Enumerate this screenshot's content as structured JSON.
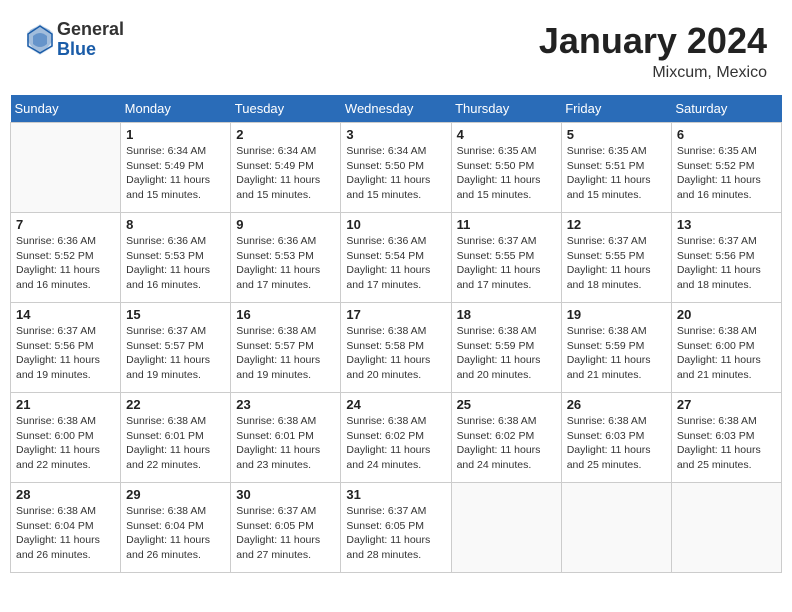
{
  "header": {
    "logo_general": "General",
    "logo_blue": "Blue",
    "month_title": "January 2024",
    "location": "Mixcum, Mexico"
  },
  "weekdays": [
    "Sunday",
    "Monday",
    "Tuesday",
    "Wednesday",
    "Thursday",
    "Friday",
    "Saturday"
  ],
  "weeks": [
    [
      {
        "day": "",
        "sunrise": "",
        "sunset": "",
        "daylight": ""
      },
      {
        "day": "1",
        "sunrise": "Sunrise: 6:34 AM",
        "sunset": "Sunset: 5:49 PM",
        "daylight": "Daylight: 11 hours and 15 minutes."
      },
      {
        "day": "2",
        "sunrise": "Sunrise: 6:34 AM",
        "sunset": "Sunset: 5:49 PM",
        "daylight": "Daylight: 11 hours and 15 minutes."
      },
      {
        "day": "3",
        "sunrise": "Sunrise: 6:34 AM",
        "sunset": "Sunset: 5:50 PM",
        "daylight": "Daylight: 11 hours and 15 minutes."
      },
      {
        "day": "4",
        "sunrise": "Sunrise: 6:35 AM",
        "sunset": "Sunset: 5:50 PM",
        "daylight": "Daylight: 11 hours and 15 minutes."
      },
      {
        "day": "5",
        "sunrise": "Sunrise: 6:35 AM",
        "sunset": "Sunset: 5:51 PM",
        "daylight": "Daylight: 11 hours and 15 minutes."
      },
      {
        "day": "6",
        "sunrise": "Sunrise: 6:35 AM",
        "sunset": "Sunset: 5:52 PM",
        "daylight": "Daylight: 11 hours and 16 minutes."
      }
    ],
    [
      {
        "day": "7",
        "sunrise": "Sunrise: 6:36 AM",
        "sunset": "Sunset: 5:52 PM",
        "daylight": "Daylight: 11 hours and 16 minutes."
      },
      {
        "day": "8",
        "sunrise": "Sunrise: 6:36 AM",
        "sunset": "Sunset: 5:53 PM",
        "daylight": "Daylight: 11 hours and 16 minutes."
      },
      {
        "day": "9",
        "sunrise": "Sunrise: 6:36 AM",
        "sunset": "Sunset: 5:53 PM",
        "daylight": "Daylight: 11 hours and 17 minutes."
      },
      {
        "day": "10",
        "sunrise": "Sunrise: 6:36 AM",
        "sunset": "Sunset: 5:54 PM",
        "daylight": "Daylight: 11 hours and 17 minutes."
      },
      {
        "day": "11",
        "sunrise": "Sunrise: 6:37 AM",
        "sunset": "Sunset: 5:55 PM",
        "daylight": "Daylight: 11 hours and 17 minutes."
      },
      {
        "day": "12",
        "sunrise": "Sunrise: 6:37 AM",
        "sunset": "Sunset: 5:55 PM",
        "daylight": "Daylight: 11 hours and 18 minutes."
      },
      {
        "day": "13",
        "sunrise": "Sunrise: 6:37 AM",
        "sunset": "Sunset: 5:56 PM",
        "daylight": "Daylight: 11 hours and 18 minutes."
      }
    ],
    [
      {
        "day": "14",
        "sunrise": "Sunrise: 6:37 AM",
        "sunset": "Sunset: 5:56 PM",
        "daylight": "Daylight: 11 hours and 19 minutes."
      },
      {
        "day": "15",
        "sunrise": "Sunrise: 6:37 AM",
        "sunset": "Sunset: 5:57 PM",
        "daylight": "Daylight: 11 hours and 19 minutes."
      },
      {
        "day": "16",
        "sunrise": "Sunrise: 6:38 AM",
        "sunset": "Sunset: 5:57 PM",
        "daylight": "Daylight: 11 hours and 19 minutes."
      },
      {
        "day": "17",
        "sunrise": "Sunrise: 6:38 AM",
        "sunset": "Sunset: 5:58 PM",
        "daylight": "Daylight: 11 hours and 20 minutes."
      },
      {
        "day": "18",
        "sunrise": "Sunrise: 6:38 AM",
        "sunset": "Sunset: 5:59 PM",
        "daylight": "Daylight: 11 hours and 20 minutes."
      },
      {
        "day": "19",
        "sunrise": "Sunrise: 6:38 AM",
        "sunset": "Sunset: 5:59 PM",
        "daylight": "Daylight: 11 hours and 21 minutes."
      },
      {
        "day": "20",
        "sunrise": "Sunrise: 6:38 AM",
        "sunset": "Sunset: 6:00 PM",
        "daylight": "Daylight: 11 hours and 21 minutes."
      }
    ],
    [
      {
        "day": "21",
        "sunrise": "Sunrise: 6:38 AM",
        "sunset": "Sunset: 6:00 PM",
        "daylight": "Daylight: 11 hours and 22 minutes."
      },
      {
        "day": "22",
        "sunrise": "Sunrise: 6:38 AM",
        "sunset": "Sunset: 6:01 PM",
        "daylight": "Daylight: 11 hours and 22 minutes."
      },
      {
        "day": "23",
        "sunrise": "Sunrise: 6:38 AM",
        "sunset": "Sunset: 6:01 PM",
        "daylight": "Daylight: 11 hours and 23 minutes."
      },
      {
        "day": "24",
        "sunrise": "Sunrise: 6:38 AM",
        "sunset": "Sunset: 6:02 PM",
        "daylight": "Daylight: 11 hours and 24 minutes."
      },
      {
        "day": "25",
        "sunrise": "Sunrise: 6:38 AM",
        "sunset": "Sunset: 6:02 PM",
        "daylight": "Daylight: 11 hours and 24 minutes."
      },
      {
        "day": "26",
        "sunrise": "Sunrise: 6:38 AM",
        "sunset": "Sunset: 6:03 PM",
        "daylight": "Daylight: 11 hours and 25 minutes."
      },
      {
        "day": "27",
        "sunrise": "Sunrise: 6:38 AM",
        "sunset": "Sunset: 6:03 PM",
        "daylight": "Daylight: 11 hours and 25 minutes."
      }
    ],
    [
      {
        "day": "28",
        "sunrise": "Sunrise: 6:38 AM",
        "sunset": "Sunset: 6:04 PM",
        "daylight": "Daylight: 11 hours and 26 minutes."
      },
      {
        "day": "29",
        "sunrise": "Sunrise: 6:38 AM",
        "sunset": "Sunset: 6:04 PM",
        "daylight": "Daylight: 11 hours and 26 minutes."
      },
      {
        "day": "30",
        "sunrise": "Sunrise: 6:37 AM",
        "sunset": "Sunset: 6:05 PM",
        "daylight": "Daylight: 11 hours and 27 minutes."
      },
      {
        "day": "31",
        "sunrise": "Sunrise: 6:37 AM",
        "sunset": "Sunset: 6:05 PM",
        "daylight": "Daylight: 11 hours and 28 minutes."
      },
      {
        "day": "",
        "sunrise": "",
        "sunset": "",
        "daylight": ""
      },
      {
        "day": "",
        "sunrise": "",
        "sunset": "",
        "daylight": ""
      },
      {
        "day": "",
        "sunrise": "",
        "sunset": "",
        "daylight": ""
      }
    ]
  ]
}
